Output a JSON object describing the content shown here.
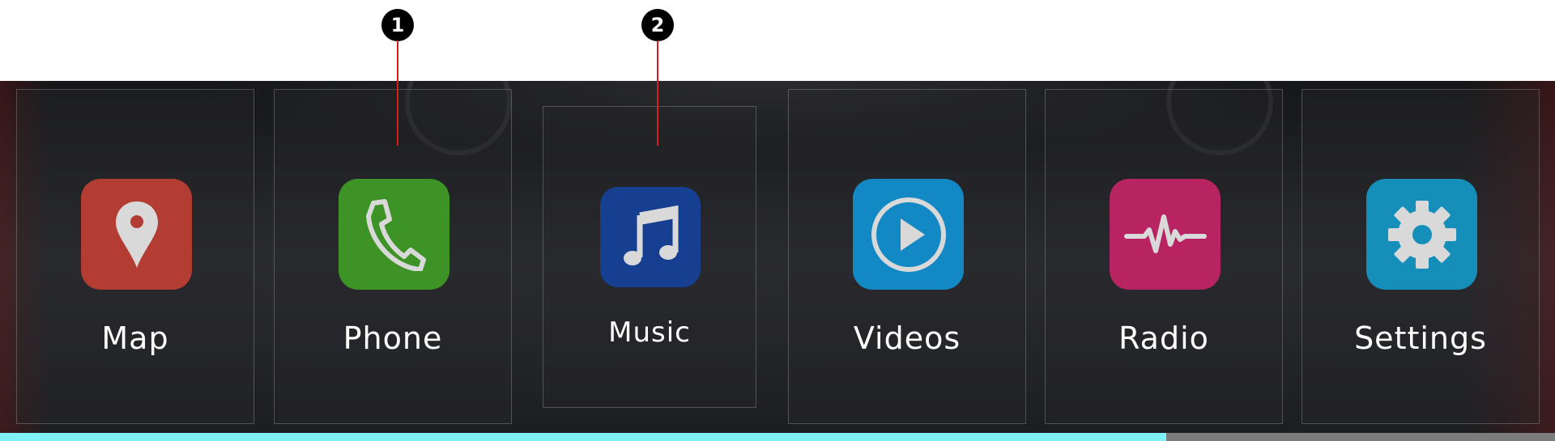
{
  "callouts": [
    "1",
    "2"
  ],
  "apps": [
    {
      "id": "map",
      "label": "Map",
      "icon": "map-pin-icon",
      "color": "#b33d32"
    },
    {
      "id": "phone",
      "label": "Phone",
      "icon": "phone-icon",
      "color": "#3d9326"
    },
    {
      "id": "music",
      "label": "Music",
      "icon": "music-note-icon",
      "color": "#163e91"
    },
    {
      "id": "videos",
      "label": "Videos",
      "icon": "play-icon",
      "color": "#1289c4"
    },
    {
      "id": "radio",
      "label": "Radio",
      "icon": "waveform-icon",
      "color": "#b82462"
    },
    {
      "id": "settings",
      "label": "Settings",
      "icon": "gear-icon",
      "color": "#158fb9"
    }
  ],
  "icon_glyph_color": "#d9d9d9",
  "callout_line_color": "#d81b1b",
  "progress": {
    "value": 0.75,
    "fill_color": "#7ff0f6",
    "track_color": "#7c7c7c"
  }
}
